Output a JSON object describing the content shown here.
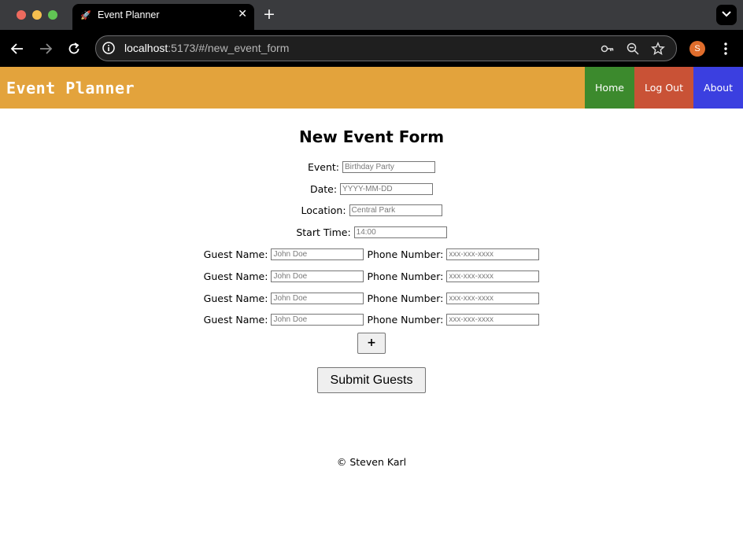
{
  "browser": {
    "tab_title": "Event Planner",
    "tab_close": "✕",
    "new_tab": "+",
    "url_host": "localhost",
    "url_rest": ":5173/#/new_event_form",
    "avatar_letter": "S"
  },
  "header": {
    "title": "Event Planner",
    "nav": {
      "home": "Home",
      "logout": "Log Out",
      "about": "About"
    },
    "colors": {
      "bar": "#e3a33c",
      "home": "#3c8a2d",
      "logout": "#c95236",
      "about": "#3b3fe0"
    }
  },
  "form": {
    "title": "New Event Form",
    "event": {
      "label": "Event:",
      "placeholder": "Birthday Party"
    },
    "date": {
      "label": "Date:",
      "placeholder": "YYYY-MM-DD"
    },
    "location": {
      "label": "Location:",
      "placeholder": "Central Park"
    },
    "start_time": {
      "label": "Start Time:",
      "placeholder": "14:00"
    },
    "guests": [
      {
        "name_label": "Guest Name:",
        "name_placeholder": "John Doe",
        "phone_label": "Phone Number:",
        "phone_placeholder": "xxx-xxx-xxxx"
      },
      {
        "name_label": "Guest Name:",
        "name_placeholder": "John Doe",
        "phone_label": "Phone Number:",
        "phone_placeholder": "xxx-xxx-xxxx"
      },
      {
        "name_label": "Guest Name:",
        "name_placeholder": "John Doe",
        "phone_label": "Phone Number:",
        "phone_placeholder": "xxx-xxx-xxxx"
      },
      {
        "name_label": "Guest Name:",
        "name_placeholder": "John Doe",
        "phone_label": "Phone Number:",
        "phone_placeholder": "xxx-xxx-xxxx"
      }
    ],
    "add_guest_label": "+",
    "submit_label": "Submit Guests"
  },
  "footer": {
    "text": "© Steven Karl"
  }
}
